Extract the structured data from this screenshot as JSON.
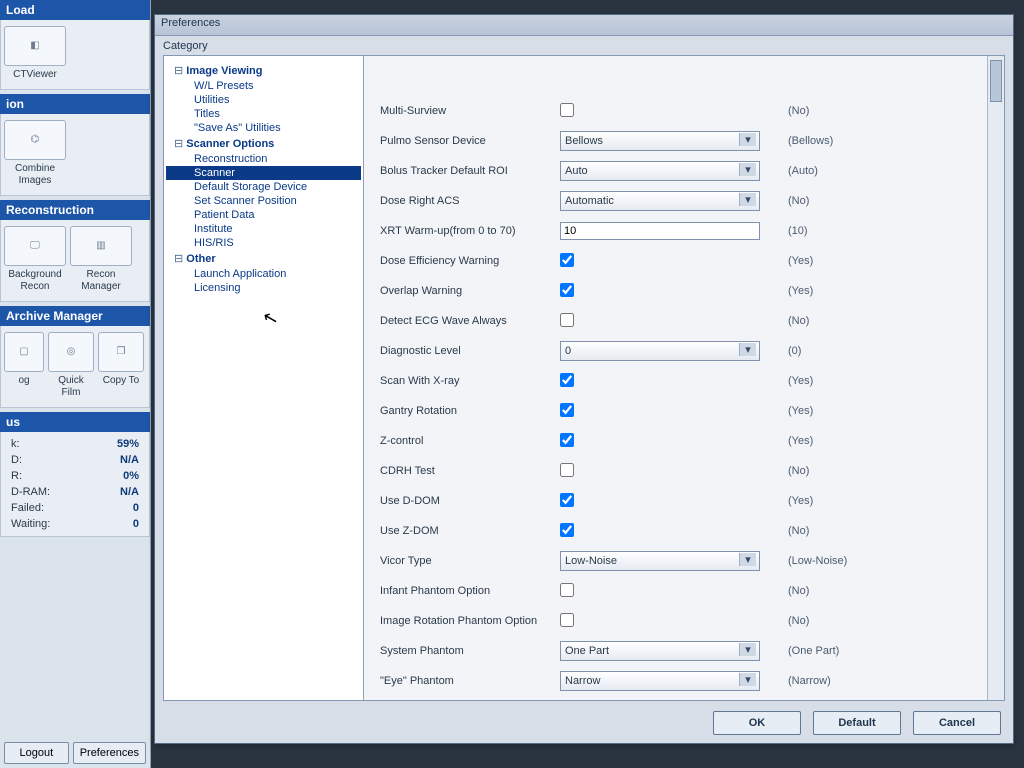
{
  "sidebar": {
    "groups": [
      {
        "title": "Load",
        "tiles": [
          {
            "name": "ctviewer",
            "icon": "cube-icon",
            "label": "CTViewer"
          }
        ]
      },
      {
        "title": "ion",
        "tiles": [
          {
            "name": "combine",
            "icon": "tree-icon",
            "label": "Combine Images"
          }
        ]
      },
      {
        "title": "Reconstruction",
        "tiles": [
          {
            "name": "bg-recon",
            "icon": "monitor-icon",
            "label": "Background\nRecon"
          },
          {
            "name": "recon-mgr",
            "icon": "stack-icon",
            "label": "Recon\nManager"
          }
        ]
      },
      {
        "title": "Archive Manager",
        "tiles": [
          {
            "name": "tile-a",
            "icon": "doc-icon",
            "label": "og"
          },
          {
            "name": "quick-film",
            "icon": "camera-icon",
            "label": "Quick\nFilm"
          },
          {
            "name": "copy-to",
            "icon": "doc-stack-icon",
            "label": "Copy\nTo"
          }
        ]
      },
      {
        "title": "us",
        "stats": [
          {
            "k": "k:",
            "v": "59%"
          },
          {
            "k": "D:",
            "v": "N/A"
          },
          {
            "k": "R:",
            "v": "0%"
          },
          {
            "k": "D-RAM:",
            "v": "N/A"
          },
          {
            "k": "Failed:",
            "v": "0"
          },
          {
            "k": "Waiting:",
            "v": "0"
          }
        ]
      }
    ],
    "bottom": {
      "logout": "Logout",
      "prefs": "Preferences"
    }
  },
  "dialog": {
    "title": "Preferences",
    "category_label": "Category",
    "buttons": {
      "ok": "OK",
      "default": "Default",
      "cancel": "Cancel"
    },
    "tree": {
      "groups": [
        {
          "label": "Image Viewing",
          "items": [
            "W/L Presets",
            "Utilities",
            "Titles",
            "\"Save As\" Utilities"
          ]
        },
        {
          "label": "Scanner Options",
          "items": [
            "Reconstruction",
            "Scanner",
            "Default Storage Device",
            "Set Scanner Position",
            "Patient Data",
            "Institute",
            "HIS/RIS"
          ],
          "selected": "Scanner"
        },
        {
          "label": "Other",
          "items": [
            "Launch Application",
            "Licensing"
          ]
        }
      ]
    },
    "form": [
      {
        "label": "Multi-Surview",
        "type": "check",
        "value": false,
        "hint": "(No)"
      },
      {
        "label": "Pulmo Sensor Device",
        "type": "select",
        "value": "Bellows",
        "hint": "(Bellows)"
      },
      {
        "label": "Bolus Tracker Default ROI",
        "type": "select",
        "value": "Auto",
        "hint": "(Auto)"
      },
      {
        "label": "Dose Right ACS",
        "type": "select",
        "value": "Automatic",
        "hint": "(No)"
      },
      {
        "label": "XRT Warm-up(from 0 to 70)",
        "type": "text",
        "value": "10",
        "hint": "(10)"
      },
      {
        "label": "Dose Efficiency Warning",
        "type": "check",
        "value": true,
        "hint": "(Yes)"
      },
      {
        "label": "Overlap Warning",
        "type": "check",
        "value": true,
        "hint": "(Yes)"
      },
      {
        "label": "Detect ECG Wave Always",
        "type": "check",
        "value": false,
        "hint": "(No)"
      },
      {
        "label": "Diagnostic Level",
        "type": "select",
        "value": "0",
        "hint": "(0)"
      },
      {
        "label": "Scan With X-ray",
        "type": "check",
        "value": true,
        "hint": "(Yes)"
      },
      {
        "label": "Gantry Rotation",
        "type": "check",
        "value": true,
        "hint": "(Yes)"
      },
      {
        "label": "Z-control",
        "type": "check",
        "value": true,
        "hint": "(Yes)"
      },
      {
        "label": "CDRH Test",
        "type": "check",
        "value": false,
        "hint": "(No)"
      },
      {
        "label": "Use D-DOM",
        "type": "check",
        "value": true,
        "hint": "(Yes)"
      },
      {
        "label": "Use Z-DOM",
        "type": "check",
        "value": true,
        "hint": "(No)"
      },
      {
        "label": "Vicor Type",
        "type": "select",
        "value": "Low-Noise",
        "hint": "(Low-Noise)"
      },
      {
        "label": "Infant Phantom Option",
        "type": "check",
        "value": false,
        "hint": "(No)"
      },
      {
        "label": "Image Rotation Phantom Option",
        "type": "check",
        "value": false,
        "hint": "(No)"
      },
      {
        "label": "System Phantom",
        "type": "select",
        "value": "One Part",
        "hint": "(One Part)"
      },
      {
        "label": "\"Eye\" Phantom",
        "type": "select",
        "value": "Narrow",
        "hint": "(Narrow)"
      }
    ]
  },
  "icons": {
    "cube-icon": "◧",
    "tree-icon": "⌬",
    "monitor-icon": "🖵",
    "stack-icon": "▥",
    "doc-icon": "▢",
    "camera-icon": "◎",
    "doc-stack-icon": "❐"
  }
}
